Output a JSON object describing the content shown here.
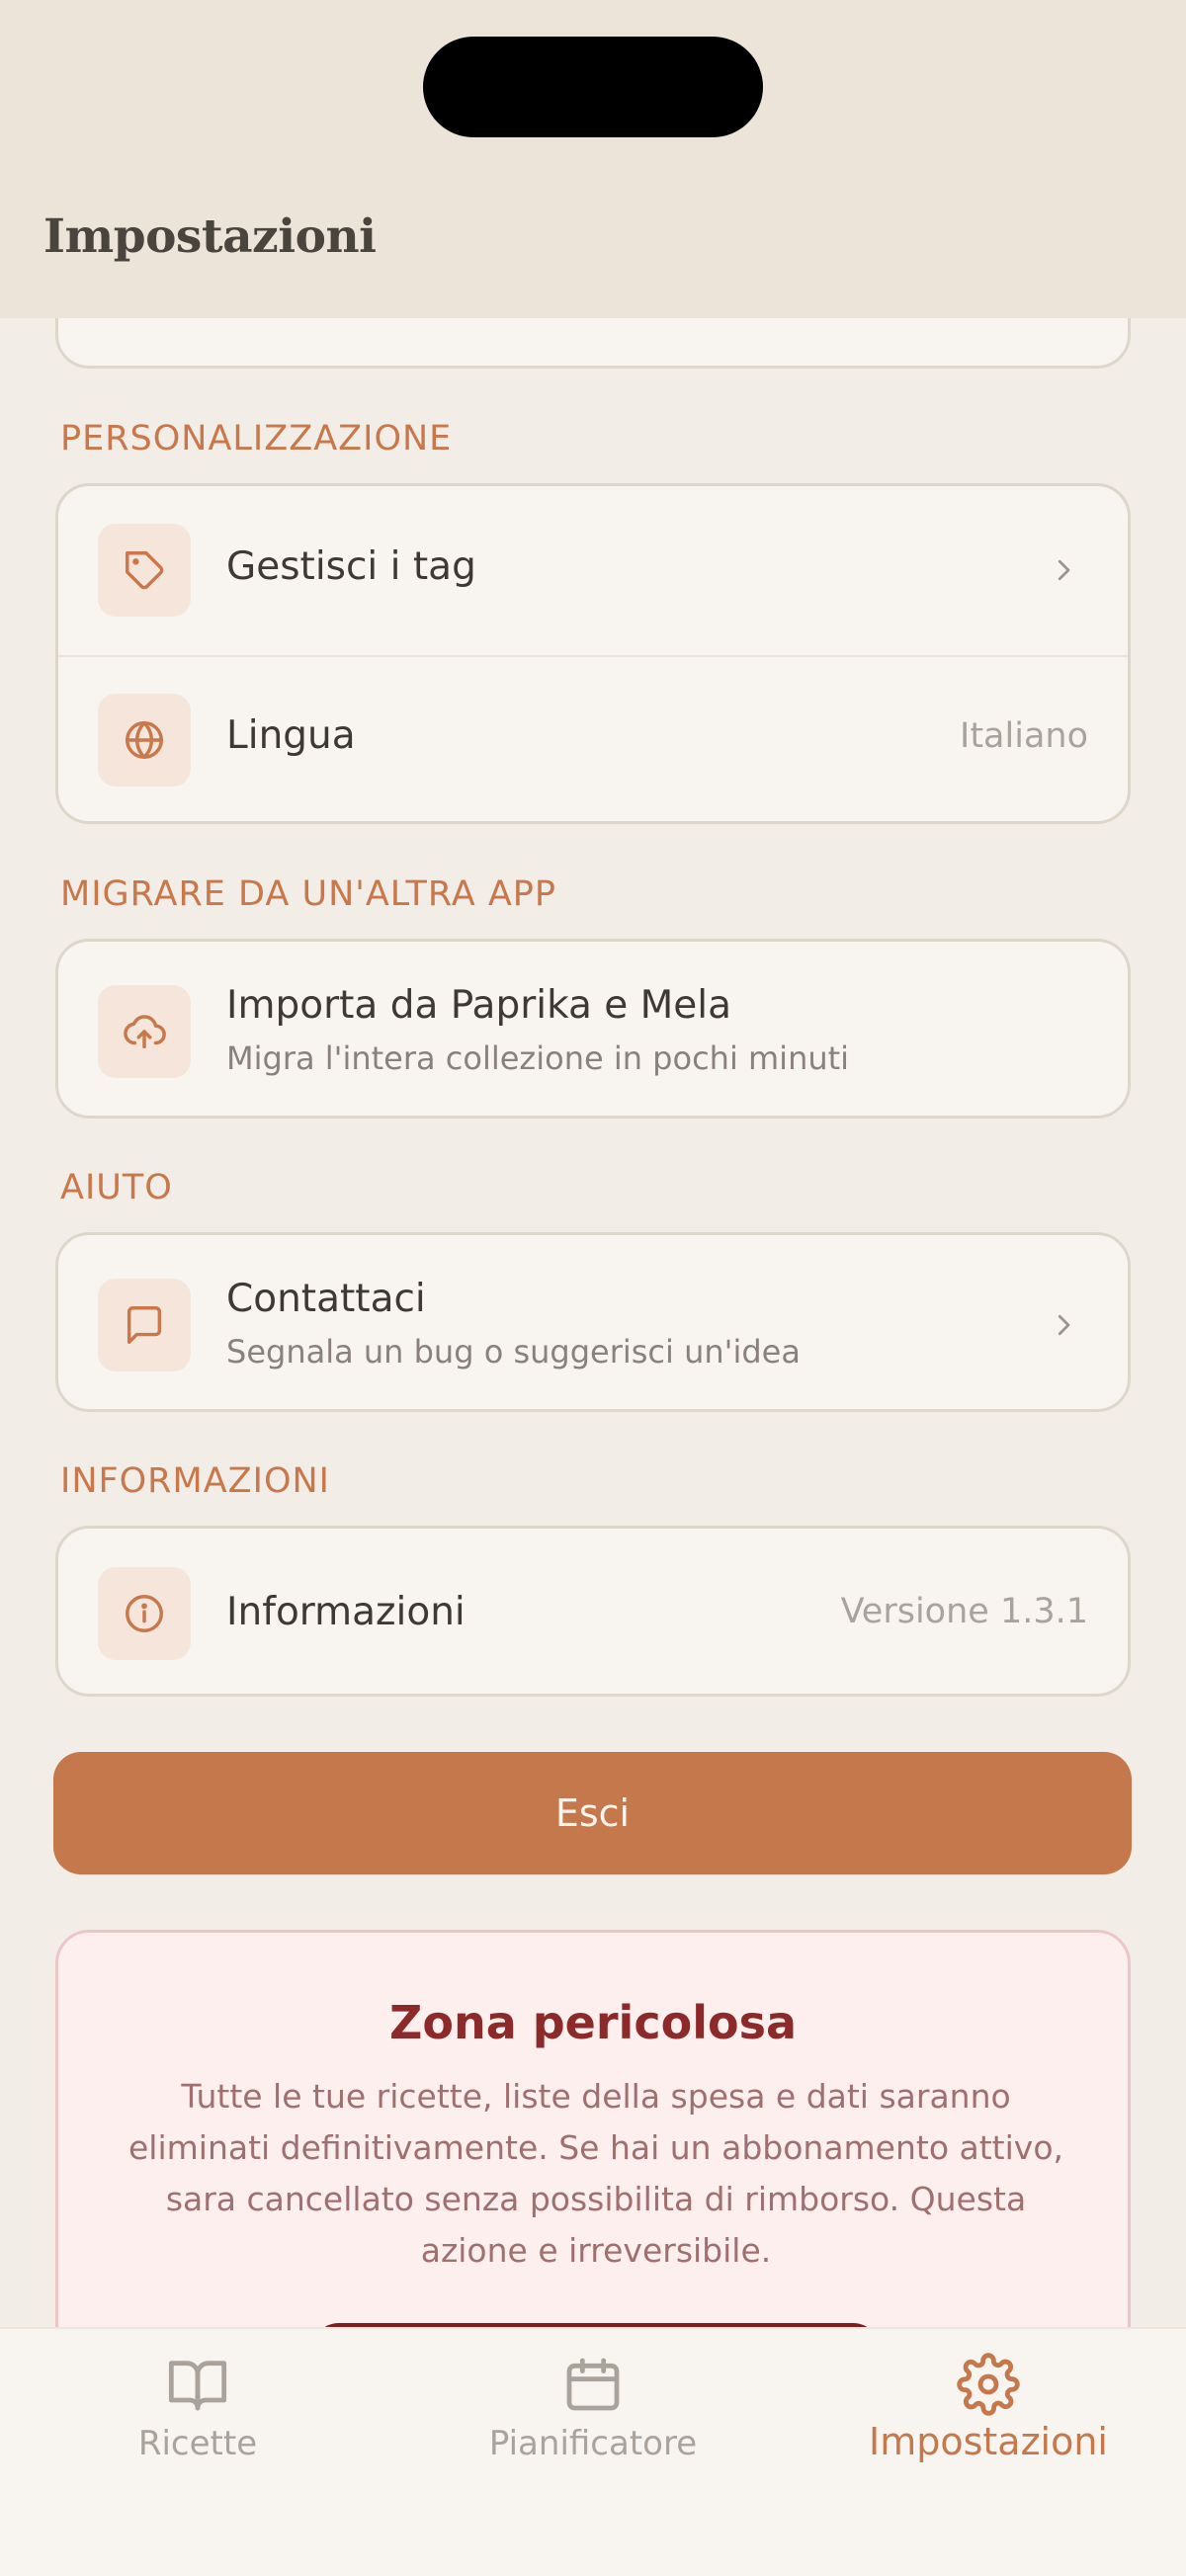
{
  "header": {
    "title": "Impostazioni"
  },
  "sections": {
    "personalization": {
      "label": "PERSONALIZZAZIONE",
      "manage_tags": {
        "title": "Gestisci i tag",
        "icon": "tag-icon"
      },
      "language": {
        "title": "Lingua",
        "value": "Italiano",
        "icon": "globe-icon"
      }
    },
    "migrate": {
      "label": "MIGRARE DA UN'ALTRA APP",
      "import": {
        "title": "Importa da Paprika e Mela",
        "subtitle": "Migra l'intera collezione in pochi minuti",
        "icon": "cloud-upload-icon"
      }
    },
    "help": {
      "label": "AIUTO",
      "contact": {
        "title": "Contattaci",
        "subtitle": "Segnala un bug o suggerisci un'idea",
        "icon": "message-icon"
      }
    },
    "info": {
      "label": "INFORMAZIONI",
      "about": {
        "title": "Informazioni",
        "value": "Versione 1.3.1",
        "icon": "info-icon"
      }
    }
  },
  "logout": {
    "label": "Esci"
  },
  "danger_zone": {
    "title": "Zona pericolosa",
    "text": "Tutte le tue ricette, liste della spesa e dati saranno eliminati definitivamente. Se hai un abbonamento attivo, sara cancellato senza possibilita di rimborso. Questa azione e irreversibile."
  },
  "tabs": [
    {
      "label": "Ricette",
      "icon": "book-icon",
      "active": false
    },
    {
      "label": "Pianificatore",
      "icon": "calendar-icon",
      "active": false
    },
    {
      "label": "Impostazioni",
      "icon": "gear-icon",
      "active": true
    }
  ],
  "colors": {
    "accent": "#c4784b",
    "background": "#f2ede6",
    "danger": "#8c2a2a"
  }
}
